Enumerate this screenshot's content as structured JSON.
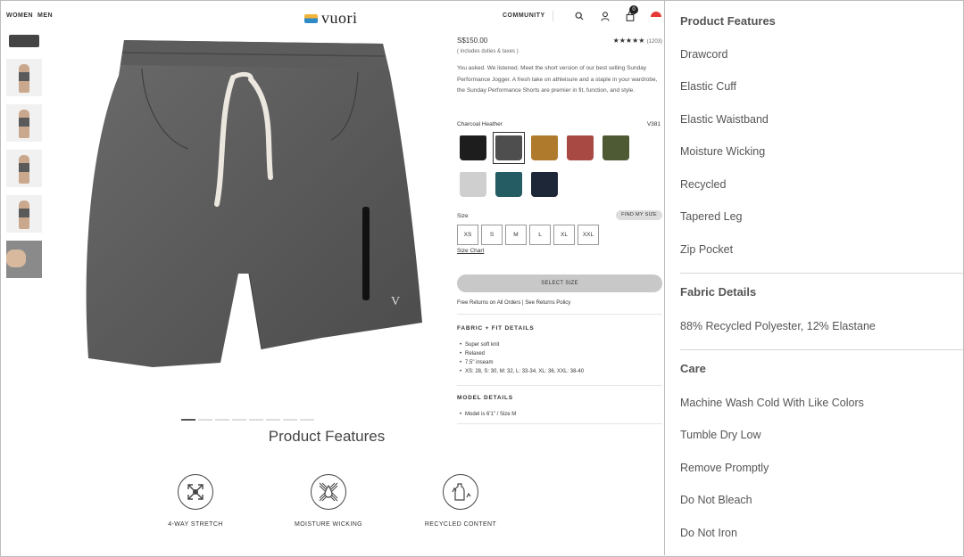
{
  "nav": {
    "women": "WOMEN",
    "men": "MEN",
    "logo": "vuori",
    "community": "COMMUNITY",
    "cart_count": "0",
    "icons": [
      "search-icon",
      "account-icon",
      "bag-icon",
      "flag-icon"
    ]
  },
  "product": {
    "price": "S$150.00",
    "rating_stars": "★★★★★",
    "rating_count": "(1203)",
    "tax_note": "( includes duties & taxes )",
    "description": "You asked. We listened. Meet the short version of our best selling Sunday Performance Jogger. A fresh take on athleisure and a staple in your wardrobe, the Sunday Performance Shorts are premier in fit, function, and style.",
    "color_name": "Charcoal Heather",
    "sku": "V381",
    "swatches": [
      {
        "name": "black",
        "color": "#1d1d1d"
      },
      {
        "name": "charcoal-heather",
        "color": "#4e4e4e"
      },
      {
        "name": "ochre",
        "color": "#b07a2c"
      },
      {
        "name": "brick",
        "color": "#a84a43"
      },
      {
        "name": "olive",
        "color": "#4d5a34"
      },
      {
        "name": "light-heather",
        "color": "#cfcfcf"
      },
      {
        "name": "teal",
        "color": "#255c63"
      },
      {
        "name": "navy",
        "color": "#1d2738"
      }
    ],
    "selected_swatch_index": 1,
    "size_label": "Size",
    "find_size": "FIND MY SIZE",
    "sizes": [
      "XS",
      "S",
      "M",
      "L",
      "XL",
      "XXL"
    ],
    "size_chart": "Size Chart",
    "select_button": "SELECT SIZE",
    "returns": "Free Returns on All Orders | See Returns Policy",
    "fabric_title": "FABRIC + FIT DETAILS",
    "fabric_bullets": [
      "Super soft knit",
      "Relaxed",
      "7.5\" inseam",
      "XS: 28, S: 30, M: 32, L: 33-34, XL: 36, XXL: 38-40"
    ],
    "model_title": "MODEL DETAILS",
    "model_bullets": [
      "Model is 6'1\" / Size M"
    ]
  },
  "gallery": {
    "active_image_index": 0,
    "image_count": 8
  },
  "features_section": {
    "heading": "Product Features",
    "items": [
      {
        "label": "4-WAY STRETCH",
        "icon": "stretch-icon"
      },
      {
        "label": "MOISTURE WICKING",
        "icon": "moisture-wicking-icon"
      },
      {
        "label": "RECYCLED CONTENT",
        "icon": "recycled-bottle-icon"
      }
    ]
  },
  "panel": {
    "features_title": "Product Features",
    "features": [
      "Drawcord",
      "Elastic Cuff",
      "Elastic Waistband",
      "Moisture Wicking",
      "Recycled",
      "Tapered Leg",
      "Zip Pocket"
    ],
    "fabric_title": "Fabric Details",
    "fabric": "88% Recycled Polyester, 12% Elastane",
    "care_title": "Care",
    "care": [
      "Machine Wash Cold With Like Colors",
      "Tumble Dry Low",
      "Remove Promptly",
      "Do Not Bleach",
      "Do Not Iron"
    ]
  }
}
